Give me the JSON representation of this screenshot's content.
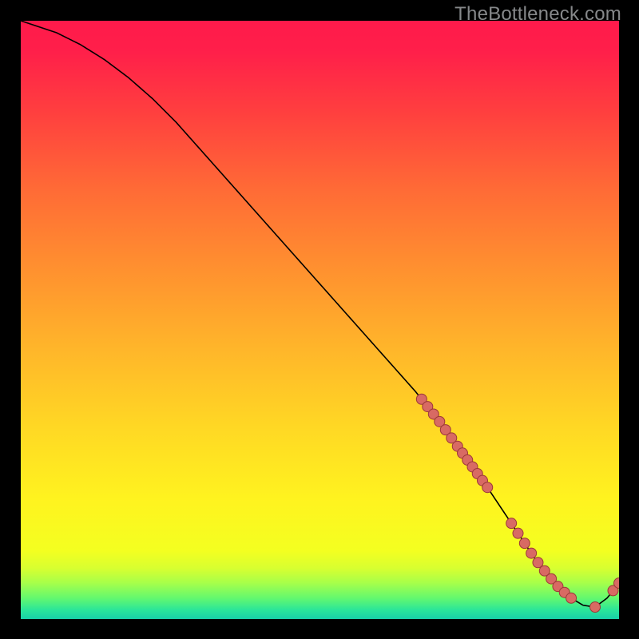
{
  "watermark": "TheBottleneck.com",
  "chart_data": {
    "type": "line",
    "title": "",
    "xlabel": "",
    "ylabel": "",
    "xlim": [
      0,
      100
    ],
    "ylim": [
      0,
      100
    ],
    "series": [
      {
        "name": "curve",
        "x": [
          0,
          3,
          6,
          10,
          14,
          18,
          22,
          26,
          30,
          34,
          38,
          42,
          46,
          50,
          54,
          58,
          62,
          66,
          70,
          74,
          78,
          80,
          82,
          84,
          86,
          88,
          90,
          92,
          94,
          96,
          98,
          100
        ],
        "y": [
          100,
          99,
          98,
          96,
          93.5,
          90.5,
          87,
          83,
          78.5,
          74,
          69.5,
          65,
          60.5,
          56,
          51.5,
          47,
          42.5,
          38,
          33,
          27.5,
          22,
          19,
          16,
          13,
          10,
          7.5,
          5.2,
          3.5,
          2.3,
          2.0,
          3.5,
          6.0
        ]
      }
    ],
    "marker_clusters": [
      {
        "x_range": [
          67,
          72
        ],
        "count": 6
      },
      {
        "x_range": [
          73,
          78
        ],
        "count": 7
      },
      {
        "x_range": [
          82,
          92
        ],
        "count": 10
      },
      {
        "x_range": [
          96,
          96
        ],
        "count": 1
      },
      {
        "x_range": [
          99,
          100
        ],
        "count": 2
      }
    ],
    "gradient_stops": [
      {
        "offset": 0.0,
        "color": "#ff1a4b"
      },
      {
        "offset": 0.05,
        "color": "#ff1f4a"
      },
      {
        "offset": 0.15,
        "color": "#ff3e3f"
      },
      {
        "offset": 0.28,
        "color": "#ff6a36"
      },
      {
        "offset": 0.42,
        "color": "#ff922f"
      },
      {
        "offset": 0.55,
        "color": "#ffb62a"
      },
      {
        "offset": 0.68,
        "color": "#ffd824"
      },
      {
        "offset": 0.8,
        "color": "#fff31f"
      },
      {
        "offset": 0.885,
        "color": "#f4ff20"
      },
      {
        "offset": 0.915,
        "color": "#d8ff30"
      },
      {
        "offset": 0.94,
        "color": "#a6ff4a"
      },
      {
        "offset": 0.965,
        "color": "#63f86f"
      },
      {
        "offset": 0.985,
        "color": "#2ae59a"
      },
      {
        "offset": 1.0,
        "color": "#18cfa8"
      }
    ],
    "marker_style": {
      "fill": "#d86a63",
      "stroke": "#9c3838",
      "r": 6.5
    },
    "line_style": {
      "stroke": "#000000",
      "width": 1.6
    }
  }
}
